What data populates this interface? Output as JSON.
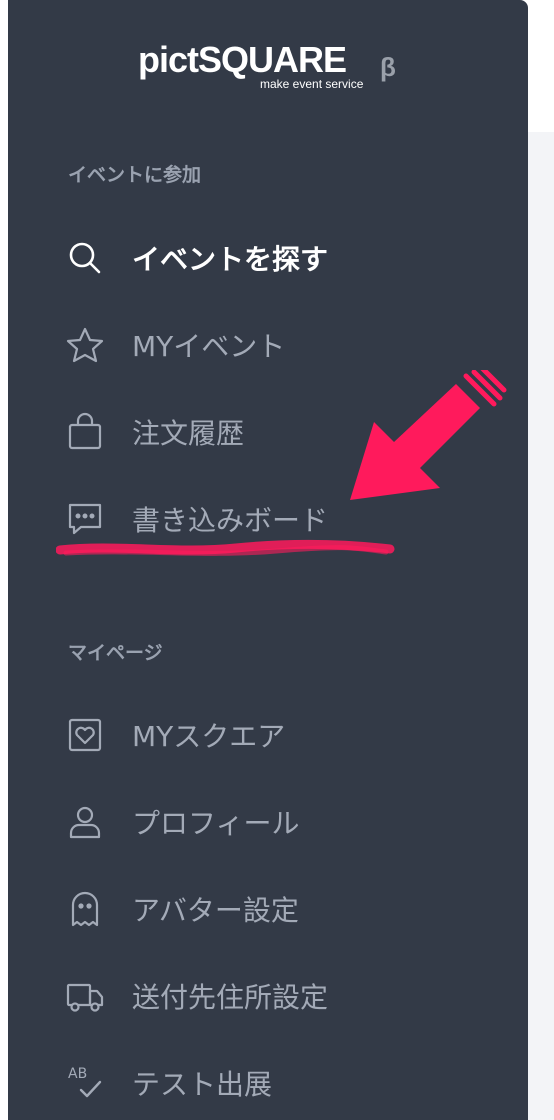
{
  "logo": {
    "main": "pictSQUARE",
    "beta": "β",
    "tagline": "make event service"
  },
  "sections": {
    "join": {
      "heading": "イベントに参加",
      "items": [
        {
          "label": "イベントを探す",
          "icon": "search-icon"
        },
        {
          "label": "MYイベント",
          "icon": "star-icon"
        },
        {
          "label": "注文履歴",
          "icon": "shopping-bag-icon"
        },
        {
          "label": "書き込みボード",
          "icon": "chat-bubble-icon"
        }
      ]
    },
    "mypage": {
      "heading": "マイページ",
      "items": [
        {
          "label": "MYスクエア",
          "icon": "heart-square-icon"
        },
        {
          "label": "プロフィール",
          "icon": "user-icon"
        },
        {
          "label": "アバター設定",
          "icon": "ghost-icon"
        },
        {
          "label": "送付先住所設定",
          "icon": "truck-icon"
        },
        {
          "label": "テスト出展",
          "icon": "ab-check-icon"
        }
      ]
    }
  },
  "icon_text": {
    "ab_icon": "AB"
  },
  "colors": {
    "sidebar_bg": "#333a47",
    "text_muted": "#a3aab7",
    "text_active": "#ffffff",
    "annotation": "#ff1a5c"
  }
}
